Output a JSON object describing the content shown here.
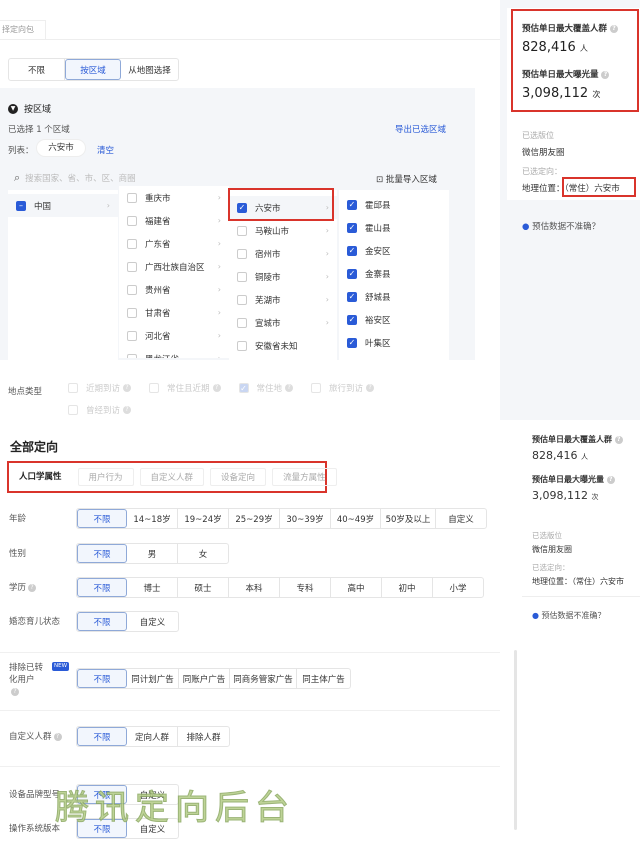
{
  "top_tab": "择定向包",
  "region_modes": {
    "options": [
      "不限",
      "按区域",
      "从地图选择"
    ],
    "selected": 1
  },
  "region": {
    "section_title": "按区域",
    "selected_count": "已选择 1 个区域",
    "export_link": "导出已选区域",
    "list_label": "列表：",
    "list_chip": "六安市",
    "clear_link": "清空",
    "search_placeholder": "搜索国家、省、市、区、商圈",
    "batch_import": "批量导入区域",
    "col1": [
      {
        "label": "中国",
        "state": "partial"
      }
    ],
    "col2": [
      "重庆市",
      "福建省",
      "广东省",
      "广西壮族自治区",
      "贵州省",
      "甘肃省",
      "河北省",
      "黑龙江省"
    ],
    "col3": [
      {
        "label": "六安市",
        "checked": true
      },
      {
        "label": "马鞍山市"
      },
      {
        "label": "宿州市"
      },
      {
        "label": "铜陵市"
      },
      {
        "label": "芜湖市"
      },
      {
        "label": "宣城市"
      },
      {
        "label": "安徽省未知"
      }
    ],
    "col4": [
      "霍邱县",
      "霍山县",
      "金安区",
      "金寨县",
      "舒城县",
      "裕安区",
      "叶集区"
    ]
  },
  "location_type": {
    "label": "地点类型",
    "options": [
      {
        "label": "近期到访",
        "checked": false
      },
      {
        "label": "常住且近期",
        "checked": false
      },
      {
        "label": "常住地",
        "checked": true
      },
      {
        "label": "旅行到访",
        "checked": false
      },
      {
        "label": "曾经到访",
        "checked": false
      }
    ]
  },
  "estimate": {
    "reach_label": "预估单日最大覆盖人群",
    "reach_value": "828,416",
    "reach_unit": "人",
    "exposure_label": "预估单日最大曝光量",
    "exposure_value": "3,098,112",
    "exposure_unit": "次",
    "placement_label": "已选版位",
    "placement_value": "微信朋友圈",
    "targeting_label": "已选定向：",
    "geo_label": "地理位置：",
    "geo_value": "（常住）六安市",
    "feedback": "预估数据不准确？"
  },
  "all_targeting": {
    "title": "全部定向",
    "tabs": [
      "人口学属性",
      "用户行为",
      "自定义人群",
      "设备定向",
      "流量方属性"
    ],
    "active_tab": 0
  },
  "rows": [
    {
      "label": "年龄",
      "options": [
        "不限",
        "14~18岁",
        "19~24岁",
        "25~29岁",
        "30~39岁",
        "40~49岁",
        "50岁及以上",
        "自定义"
      ]
    },
    {
      "label": "性别",
      "options": [
        "不限",
        "男",
        "女"
      ]
    },
    {
      "label": "学历",
      "options": [
        "不限",
        "博士",
        "硕士",
        "本科",
        "专科",
        "高中",
        "初中",
        "小学"
      ]
    },
    {
      "label": "婚恋育儿状态",
      "options": [
        "不限",
        "自定义"
      ]
    },
    {
      "label": "排除已转化用户",
      "badge": "NEW",
      "options": [
        "不限",
        "同计划广告",
        "同账户广告",
        "同商务管家广告",
        "同主体广告"
      ]
    },
    {
      "label": "自定义人群",
      "options": [
        "不限",
        "定向人群",
        "排除人群"
      ]
    },
    {
      "label": "设备品牌型号",
      "options": [
        "不限",
        "自定义"
      ]
    },
    {
      "label": "操作系统版本",
      "options": [
        "不限",
        "自定义"
      ]
    }
  ],
  "watermark": "腾讯定向后台",
  "colors": {
    "accent": "#2a5bd7",
    "highlight": "#d9342b"
  }
}
